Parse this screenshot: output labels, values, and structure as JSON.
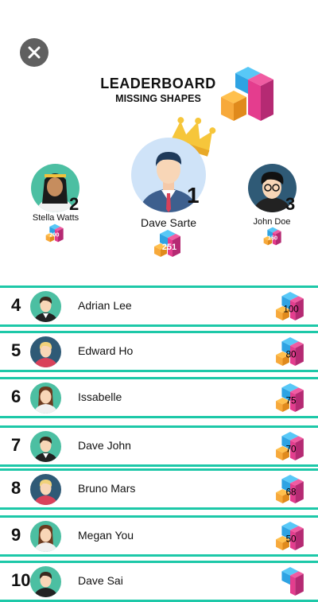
{
  "header": {
    "title": "LEADERBOARD",
    "subtitle": "MISSING SHAPES"
  },
  "podium": {
    "first": {
      "rank": "1",
      "name": "Dave Sarte",
      "score": "251"
    },
    "second": {
      "rank": "2",
      "name": "Stella Watts",
      "score": "200"
    },
    "third": {
      "rank": "3",
      "name": "John Doe",
      "score": "150"
    }
  },
  "rows": [
    {
      "rank": "4",
      "name": "Adrian Lee",
      "score": "100"
    },
    {
      "rank": "5",
      "name": "Edward Ho",
      "score": "80"
    },
    {
      "rank": "6",
      "name": "Issabelle",
      "score": "75"
    },
    {
      "rank": "7",
      "name": "Dave John",
      "score": "70"
    },
    {
      "rank": "8",
      "name": "Bruno Mars",
      "score": "68"
    },
    {
      "rank": "9",
      "name": "Megan You",
      "score": "50"
    },
    {
      "rank": "10",
      "name": "Dave Sai",
      "score": ""
    }
  ],
  "colors": {
    "accent": "#1dc8a8",
    "close_button": "#606060",
    "crown": "#f6c63b",
    "cube_blue": "#3ab4f2",
    "cube_pink": "#e43d8e",
    "cube_orange": "#f7a93b"
  }
}
